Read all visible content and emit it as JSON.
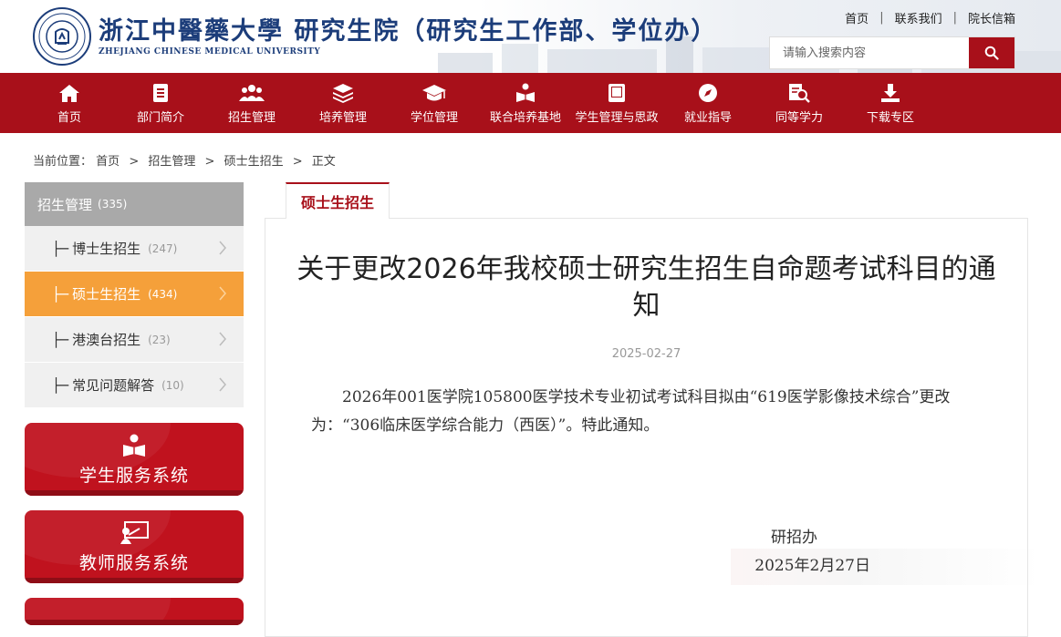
{
  "header": {
    "school_name_cn": "浙江中醫藥大學 研究生院（研究生工作部、学位办）",
    "school_name_en": "ZHEJIANG CHINESE MEDICAL UNIVERSITY",
    "top_links": [
      "首页",
      "联系我们",
      "院长信箱"
    ],
    "search_placeholder": "请输入搜索内容"
  },
  "nav": [
    {
      "label": "首页",
      "icon": "home-icon"
    },
    {
      "label": "部门简介",
      "icon": "document-icon"
    },
    {
      "label": "招生管理",
      "icon": "users-icon"
    },
    {
      "label": "培养管理",
      "icon": "layers-icon"
    },
    {
      "label": "学位管理",
      "icon": "graduation-cap-icon"
    },
    {
      "label": "联合培养基地",
      "icon": "reading-person-icon"
    },
    {
      "label": "学生管理与思政",
      "icon": "book-icon"
    },
    {
      "label": "就业指导",
      "icon": "compass-icon"
    },
    {
      "label": "同等学力",
      "icon": "search-document-icon"
    },
    {
      "label": "下载专区",
      "icon": "download-icon"
    }
  ],
  "breadcrumb": {
    "prefix": "当前位置：",
    "items": [
      "首页",
      "招生管理",
      "硕士生招生",
      "正文"
    ],
    "separator": ">"
  },
  "sidebar": {
    "head": {
      "label": "招生管理",
      "count": "(335)"
    },
    "items": [
      {
        "label": "博士生招生",
        "count": "(247)"
      },
      {
        "label": "硕士生招生",
        "count": "(434)"
      },
      {
        "label": "港澳台招生",
        "count": "(23)"
      },
      {
        "label": "常见问题解答",
        "count": "(10)"
      }
    ],
    "tree_glyph": "├─",
    "services": [
      {
        "label": "学生服务系统",
        "icon": "student-reading-icon"
      },
      {
        "label": "教师服务系统",
        "icon": "teacher-board-icon"
      }
    ]
  },
  "article": {
    "tab_label": "硕士生招生",
    "title": "关于更改2026年我校硕士研究生招生自命题考试科目的通知",
    "date": "2025-02-27",
    "body": "2026年001医学院105800医学技术专业初试考试科目拟由“619医学影像技术综合”更改为：“306临床医学综合能力（西医）”。特此通知。",
    "signature": "研招办",
    "sign_date": "2025年2月27日"
  },
  "colors": {
    "primary": "#a8101a",
    "active": "#f5a03a",
    "sidebar_head": "#a9a9a9"
  }
}
